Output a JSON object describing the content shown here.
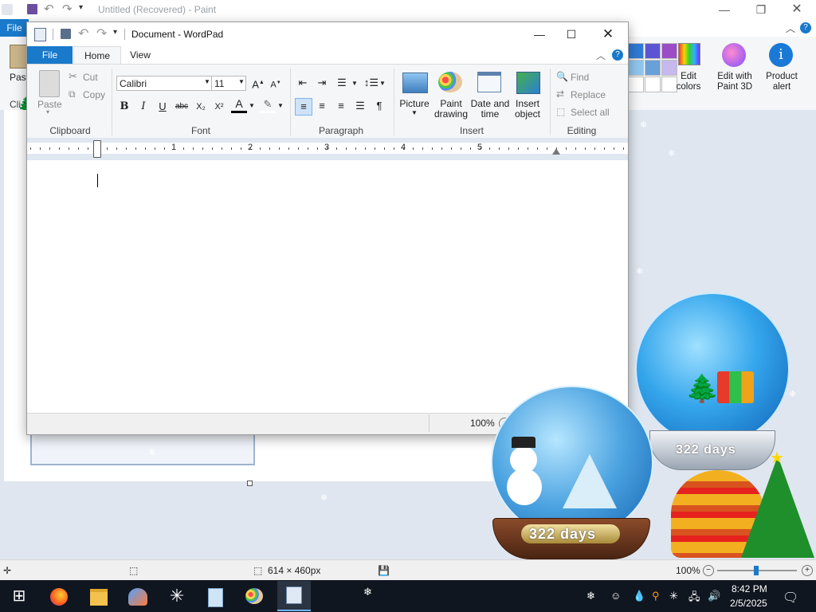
{
  "paint": {
    "title": "Untitled (Recovered) - Paint",
    "file_tab": "File",
    "paste_label": "Paste",
    "left_label": "Cli",
    "tools": {
      "edit_colors": "Edit colors",
      "edit_3d": "Edit with Paint 3D",
      "product_alert": "Product alert"
    },
    "status": {
      "size": "614 × 460px",
      "zoom": "100%"
    },
    "palette": [
      "#2e7bd6",
      "#5b55d4",
      "#9b4dc8",
      "#8fc6ee",
      "#6aa0d8",
      "#c7b8ee",
      "#ffffff",
      "#ffffff",
      "#ffffff"
    ]
  },
  "wordpad": {
    "title": "Document - WordPad",
    "tabs": {
      "file": "File",
      "home": "Home",
      "view": "View"
    },
    "clipboard": {
      "paste": "Paste",
      "cut": "Cut",
      "copy": "Copy",
      "label": "Clipboard"
    },
    "font": {
      "family": "Calibri",
      "size": "11",
      "label": "Font",
      "bold": "B",
      "italic": "I",
      "underline": "U",
      "strike": "abc",
      "subscript": "X₂",
      "superscript": "X²"
    },
    "paragraph": {
      "label": "Paragraph"
    },
    "insert": {
      "picture": "Picture",
      "paint_drawing": "Paint drawing",
      "date_time": "Date and time",
      "insert_object": "Insert object",
      "label": "Insert"
    },
    "editing": {
      "find": "Find",
      "replace": "Replace",
      "select_all": "Select all",
      "label": "Editing"
    },
    "ruler_numbers": [
      "1",
      "2",
      "3",
      "4",
      "5"
    ],
    "zoom": "100%"
  },
  "globes": {
    "days_1": "322 days",
    "days_2": "322 days"
  },
  "taskbar": {
    "time": "8:42 PM",
    "date": "2/5/2025"
  }
}
